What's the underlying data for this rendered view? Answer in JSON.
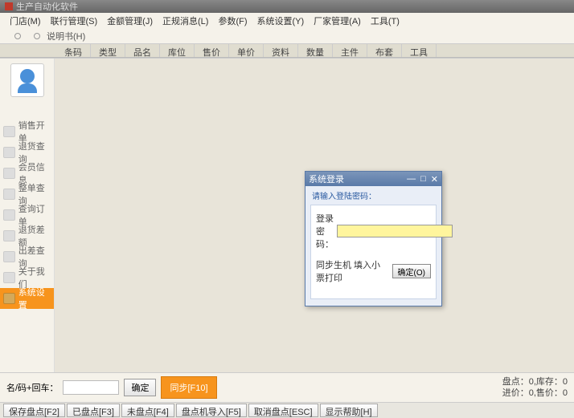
{
  "app": {
    "title": "生产自动化软件"
  },
  "menu": {
    "items": [
      "门店(M)",
      "联行管理(S)",
      "金额管理(J)",
      "正规消息(L)",
      "参数(F)",
      "系统设置(Y)",
      "厂家管理(A)",
      "工具(T)"
    ]
  },
  "sub": {
    "a": "",
    "b": "说明书(H)"
  },
  "tabs": [
    "条码",
    "类型",
    "品名",
    "库位",
    "售价",
    "单价",
    "资料",
    "数量",
    "主件",
    "布套",
    "工具"
  ],
  "side": [
    {
      "label": "销售开单"
    },
    {
      "label": "退货查询"
    },
    {
      "label": "会员信息"
    },
    {
      "label": "整单查询"
    },
    {
      "label": "查询订单"
    },
    {
      "label": "退货差额"
    },
    {
      "label": "出差查询"
    },
    {
      "label": "关于我们"
    },
    {
      "label": "系统设置"
    }
  ],
  "dialog": {
    "title": "系统登录",
    "sub": "请输入登陆密码：",
    "row1_label": "登录密码：",
    "row2_text": "同步生机 填入小票打印",
    "btn": "确定(O)"
  },
  "bar1": {
    "label": "名/码+回车：",
    "btn1": "确定",
    "btn2": "同步[F10]",
    "right1": "盘点：0,库存：0",
    "right2": "进价：0,售价：0"
  },
  "bar2": [
    "保存盘点[F2]",
    "已盘点[F3]",
    "未盘点[F4]",
    "盘点机导入[F5]",
    "取消盘点[ESC]",
    "显示帮助[H]"
  ]
}
